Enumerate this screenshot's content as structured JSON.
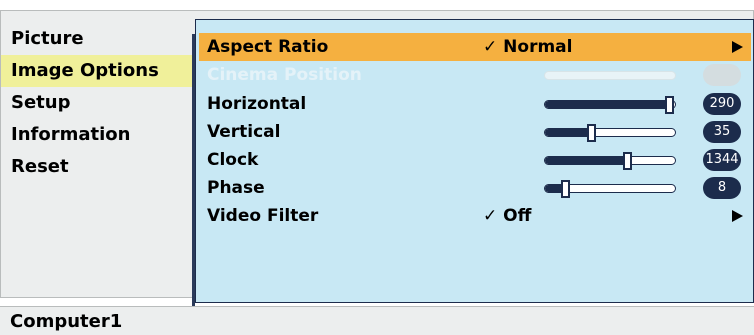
{
  "left_menu": {
    "items": [
      {
        "label": "Picture",
        "active": false
      },
      {
        "label": "Image Options",
        "active": true
      },
      {
        "label": "Setup",
        "active": false
      },
      {
        "label": "Information",
        "active": false
      },
      {
        "label": "Reset",
        "active": false
      }
    ]
  },
  "submenu": {
    "aspect_ratio": {
      "label": "Aspect Ratio",
      "value": "✓ Normal"
    },
    "cinema_position": {
      "label": "Cinema Position",
      "enabled": false
    },
    "horizontal": {
      "label": "Horizontal",
      "value": "290",
      "level": 0.95
    },
    "vertical": {
      "label": "Vertical",
      "value": "35",
      "level": 0.35
    },
    "clock": {
      "label": "Clock",
      "value": "1344",
      "level": 0.63
    },
    "phase": {
      "label": "Phase",
      "value": "8",
      "level": 0.15
    },
    "video_filter": {
      "label": "Video Filter",
      "value": "✓ Off"
    }
  },
  "status_bar": {
    "source": "Computer1"
  },
  "colors": {
    "selected_row": "#f5b040",
    "active_left_item": "#f0f09a",
    "submenu_bg": "#c8e8f4",
    "slider_dark": "#1c2c4c"
  }
}
